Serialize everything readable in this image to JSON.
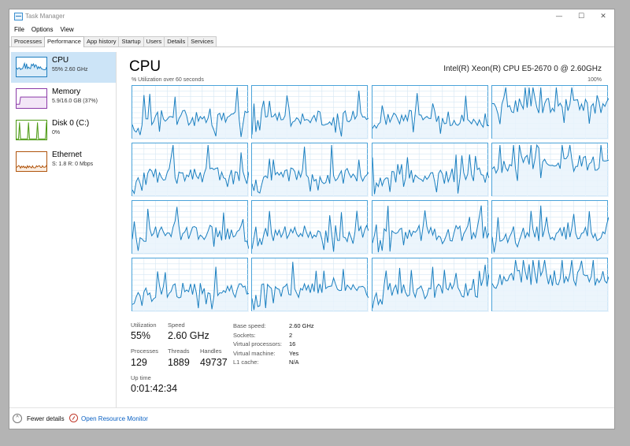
{
  "window": {
    "title": "Task Manager",
    "controls": {
      "minimize": "—",
      "maximize": "☐",
      "close": "✕"
    }
  },
  "menu": [
    "File",
    "Options",
    "View"
  ],
  "tabs": [
    {
      "label": "Processes",
      "active": false
    },
    {
      "label": "Performance",
      "active": true
    },
    {
      "label": "App history",
      "active": false
    },
    {
      "label": "Startup",
      "active": false
    },
    {
      "label": "Users",
      "active": false
    },
    {
      "label": "Details",
      "active": false
    },
    {
      "label": "Services",
      "active": false
    }
  ],
  "sidebar": [
    {
      "name": "CPU",
      "sub": "55% 2.60 GHz",
      "color": "#1f7fc0",
      "fill": "#d9ebf8",
      "selected": true
    },
    {
      "name": "Memory",
      "sub": "5.9/16.0 GB (37%)",
      "color": "#8b3aa8",
      "fill": "#f3e6f7",
      "selected": false
    },
    {
      "name": "Disk 0 (C:)",
      "sub": "0%",
      "color": "#4d9a14",
      "fill": "#eaf5e0",
      "selected": false
    },
    {
      "name": "Ethernet",
      "sub": "S: 1.8 R: 0 Mbps",
      "color": "#b0540c",
      "fill": "#fbeee2",
      "selected": false
    }
  ],
  "main": {
    "title": "CPU",
    "cpu_model": "Intel(R) Xeon(R) CPU E5-2670 0 @ 2.60GHz",
    "util_label": "% Utilization over 60 seconds",
    "util_max": "100%",
    "graph_count": 16,
    "graph_colors": {
      "line": "#1a7fc0",
      "fill": "#e9f3fb",
      "grid": "#d6e7f3",
      "border": "#4ba3d9"
    }
  },
  "stats": {
    "utilization_label": "Utilization",
    "utilization": "55%",
    "speed_label": "Speed",
    "speed": "2.60 GHz",
    "processes_label": "Processes",
    "processes": "129",
    "threads_label": "Threads",
    "threads": "1889",
    "handles_label": "Handles",
    "handles": "49737",
    "uptime_label": "Up time",
    "uptime": "0:01:42:34"
  },
  "props": [
    {
      "key": "Base speed:",
      "value": "2.60 GHz"
    },
    {
      "key": "Sockets:",
      "value": "2"
    },
    {
      "key": "Virtual processors:",
      "value": "16"
    },
    {
      "key": "Virtual machine:",
      "value": "Yes"
    },
    {
      "key": "L1 cache:",
      "value": "N/A"
    }
  ],
  "footer": {
    "fewer_details": "Fewer details",
    "resource_monitor": "Open Resource Monitor"
  }
}
